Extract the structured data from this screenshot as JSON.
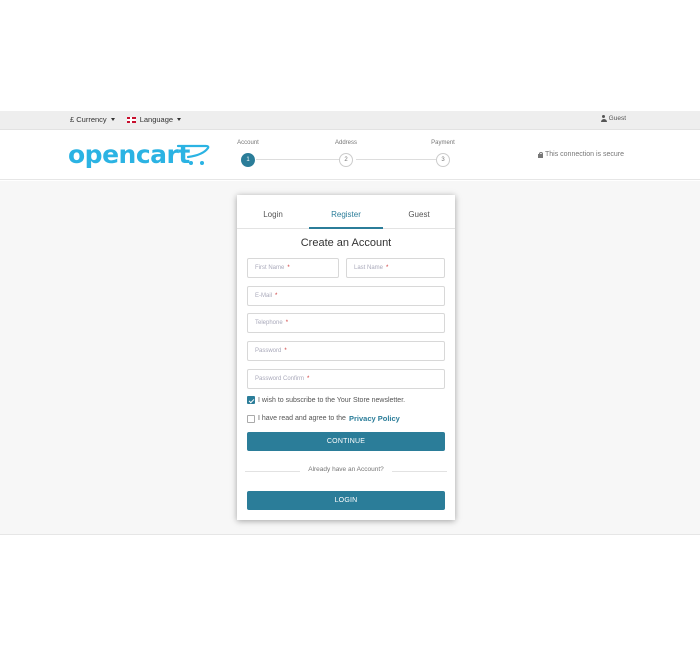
{
  "topbar": {
    "currency_label": "£ Currency",
    "language_label": "Language",
    "user_label": "Guest"
  },
  "header": {
    "logo_text": "opencart",
    "secure_text": "This connection is secure",
    "steps": [
      {
        "label": "Account",
        "number": "1"
      },
      {
        "label": "Address",
        "number": "2"
      },
      {
        "label": "Payment",
        "number": "3"
      }
    ]
  },
  "form": {
    "tabs": [
      {
        "label": "Login"
      },
      {
        "label": "Register"
      },
      {
        "label": "Guest"
      }
    ],
    "title": "Create an Account",
    "fields": {
      "first_name": "First Name",
      "last_name": "Last Name",
      "email": "E-Mail",
      "telephone": "Telephone",
      "password": "Password",
      "password_confirm": "Password Confirm",
      "required_mark": "*"
    },
    "newsletter_label": "I wish to subscribe to the Your Store newsletter.",
    "newsletter_checked": true,
    "agree_label": "I have read and agree to the",
    "privacy_link": "Privacy Policy",
    "agree_checked": false,
    "continue_label": "CONTINUE",
    "already_text": "Already have an Account?",
    "login_label": "LOGIN"
  },
  "colors": {
    "accent": "#2b7d99",
    "logo": "#2bb3e3"
  }
}
